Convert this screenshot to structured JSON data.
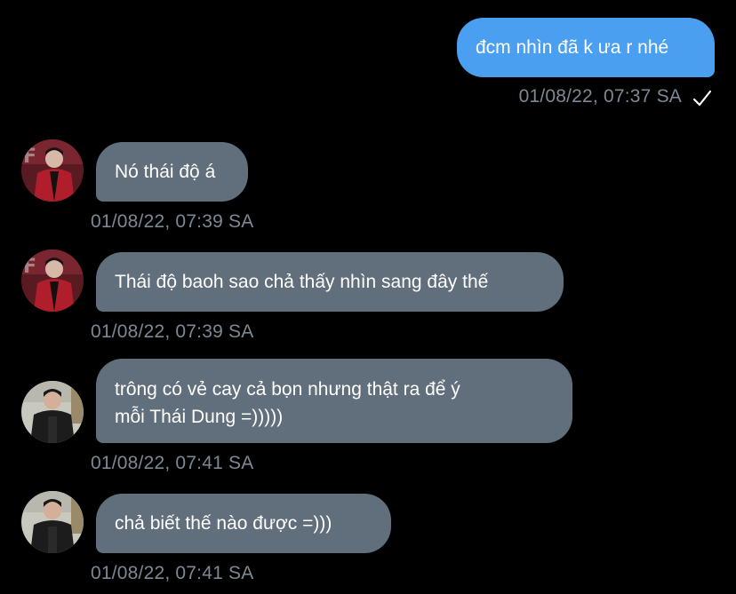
{
  "colors": {
    "background": "#000000",
    "outgoing_bubble": "#4a9ff0",
    "incoming_bubble": "#616e7b",
    "timestamp": "#7d8894",
    "text": "#ffffff"
  },
  "messages": [
    {
      "direction": "outgoing",
      "text": "đcm nhìn đã k ưa r nhé",
      "time": "01/08/22, 07:37 SA",
      "status_icon": "check-icon"
    },
    {
      "direction": "incoming",
      "text": "Nó thái độ á",
      "time": "01/08/22, 07:39 SA",
      "avatar": "red-jacket-avatar"
    },
    {
      "direction": "incoming",
      "text": "Thái độ baoh sao chả thấy nhìn sang đây thế",
      "time": "01/08/22, 07:39 SA",
      "avatar": "red-jacket-avatar"
    },
    {
      "direction": "incoming",
      "text_lines": [
        "trông có vẻ cay cả bọn nhưng thật ra để ý",
        "mỗi Thái Dung =)))))"
      ],
      "time": "01/08/22, 07:41 SA",
      "avatar": "black-outfit-avatar"
    },
    {
      "direction": "incoming",
      "text": "chả biết thế nào được =)))",
      "time": "01/08/22, 07:41 SA",
      "avatar": "black-outfit-avatar"
    }
  ]
}
